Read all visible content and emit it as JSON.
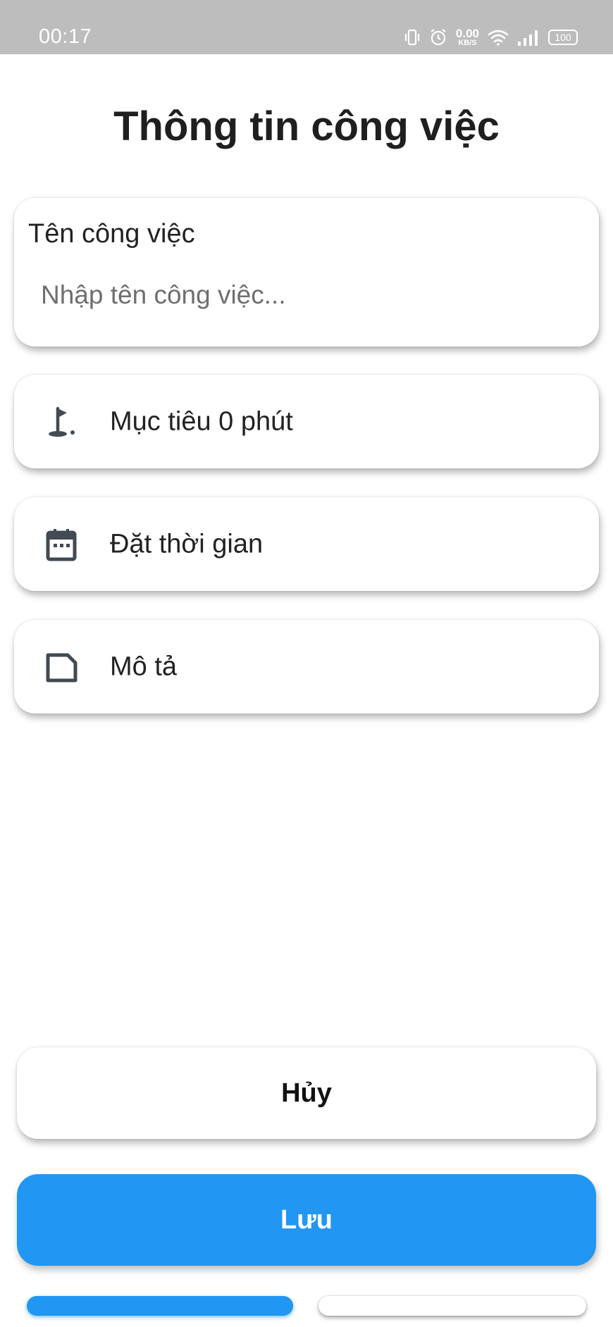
{
  "status_bar": {
    "time": "00:17",
    "net_speed_value": "0.00",
    "net_speed_unit": "KB/S",
    "battery": "100",
    "icons": [
      "vibrate-icon",
      "alarm-icon",
      "wifi-icon",
      "signal-icon",
      "battery-icon"
    ]
  },
  "page": {
    "title": "Thông tin công việc"
  },
  "task_name": {
    "label": "Tên công việc",
    "value": "",
    "placeholder": "Nhập tên công việc..."
  },
  "rows": {
    "goal": {
      "label": "Mục tiêu 0 phút",
      "icon": "golf-flag-icon"
    },
    "time": {
      "label": "Đặt thời gian",
      "icon": "calendar-icon"
    },
    "description": {
      "label": "Mô tả",
      "icon": "note-icon"
    }
  },
  "actions": {
    "cancel_label": "Hủy",
    "save_label": "Lưu"
  },
  "colors": {
    "accent": "#2196f3",
    "status_bar_bg": "#bdbdbd",
    "icon": "#424a52"
  }
}
